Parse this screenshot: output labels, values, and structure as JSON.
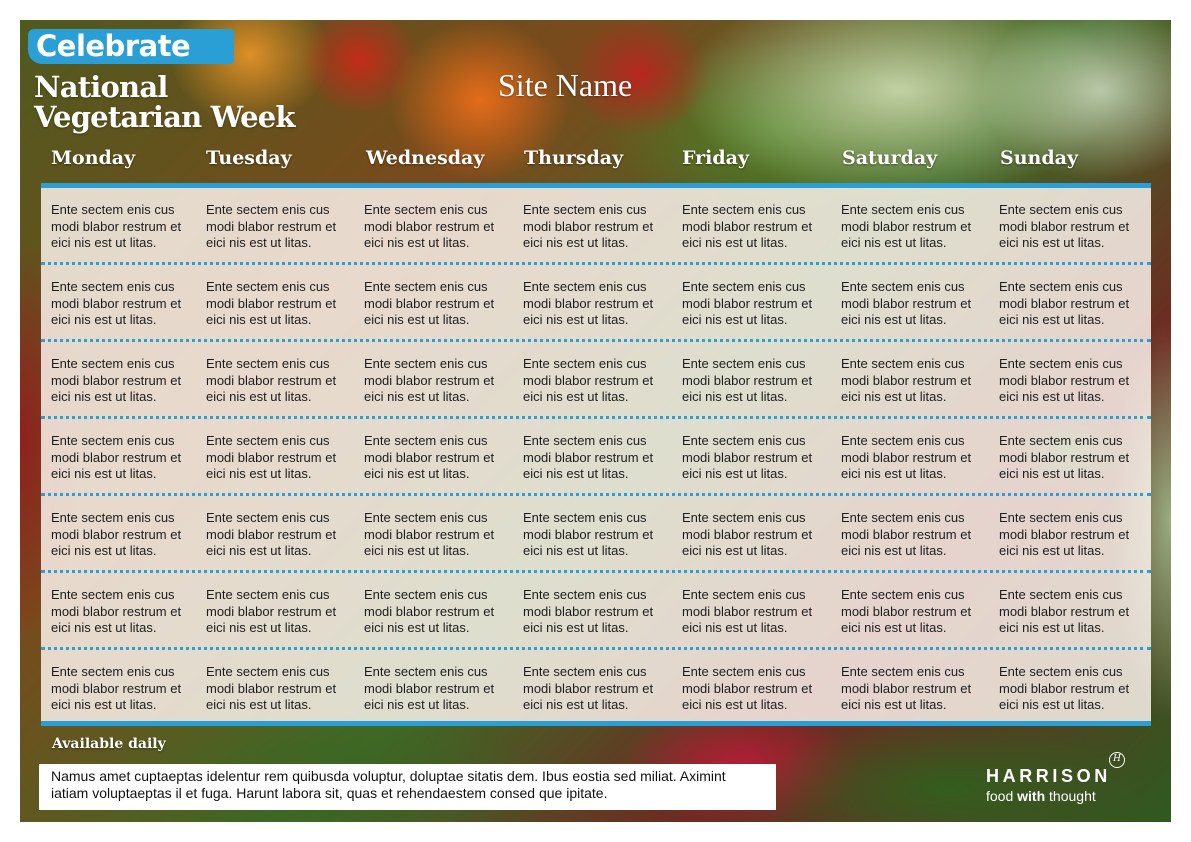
{
  "header": {
    "celebrate": "Celebrate",
    "title_line1": "National",
    "title_line2": "Vegetarian Week",
    "site_name": "Site Name"
  },
  "days": [
    "Monday",
    "Tuesday",
    "Wednesday",
    "Thursday",
    "Friday",
    "Saturday",
    "Sunday"
  ],
  "menu": {
    "rows": [
      [
        "Ente sectem enis cus modi blabor restrum et eici nis est ut litas.",
        "Ente sectem enis cus modi blabor restrum et eici nis est ut litas.",
        "Ente sectem enis cus modi blabor restrum et eici nis est ut litas.",
        "Ente sectem enis cus modi blabor restrum et eici nis est ut litas.",
        "Ente sectem enis cus modi blabor restrum et eici nis est ut litas.",
        "Ente sectem enis cus modi blabor restrum et eici nis est ut litas.",
        "Ente sectem enis cus modi blabor restrum et eici nis est ut litas."
      ],
      [
        "Ente sectem enis cus modi blabor restrum et eici nis est ut litas.",
        "Ente sectem enis cus modi blabor restrum et eici nis est ut litas.",
        "Ente sectem enis cus modi blabor restrum et eici nis est ut litas.",
        "Ente sectem enis cus modi blabor restrum et eici nis est ut litas.",
        "Ente sectem enis cus modi blabor restrum et eici nis est ut litas.",
        "Ente sectem enis cus modi blabor restrum et eici nis est ut litas.",
        "Ente sectem enis cus modi blabor restrum et eici nis est ut litas."
      ],
      [
        "Ente sectem enis cus modi blabor restrum et eici nis est ut litas.",
        "Ente sectem enis cus modi blabor restrum et eici nis est ut litas.",
        "Ente sectem enis cus modi blabor restrum et eici nis est ut litas.",
        "Ente sectem enis cus modi blabor restrum et eici nis est ut litas.",
        "Ente sectem enis cus modi blabor restrum et eici nis est ut litas.",
        "Ente sectem enis cus modi blabor restrum et eici nis est ut litas.",
        "Ente sectem enis cus modi blabor restrum et eici nis est ut litas."
      ],
      [
        "Ente sectem enis cus modi blabor restrum et eici nis est ut litas.",
        "Ente sectem enis cus modi blabor restrum et eici nis est ut litas.",
        "Ente sectem enis cus modi blabor restrum et eici nis est ut litas.",
        "Ente sectem enis cus modi blabor restrum et eici nis est ut litas.",
        "Ente sectem enis cus modi blabor restrum et eici nis est ut litas.",
        "Ente sectem enis cus modi blabor restrum et eici nis est ut litas.",
        "Ente sectem enis cus modi blabor restrum et eici nis est ut litas."
      ],
      [
        "Ente sectem enis cus modi blabor restrum et eici nis est ut litas.",
        "Ente sectem enis cus modi blabor restrum et eici nis est ut litas.",
        "Ente sectem enis cus modi blabor restrum et eici nis est ut litas.",
        "Ente sectem enis cus modi blabor restrum et eici nis est ut litas.",
        "Ente sectem enis cus modi blabor restrum et eici nis est ut litas.",
        "Ente sectem enis cus modi blabor restrum et eici nis est ut litas.",
        "Ente sectem enis cus modi blabor restrum et eici nis est ut litas."
      ],
      [
        "Ente sectem enis cus modi blabor restrum et eici nis est ut litas.",
        "Ente sectem enis cus modi blabor restrum et eici nis est ut litas.",
        "Ente sectem enis cus modi blabor restrum et eici nis est ut litas.",
        "Ente sectem enis cus modi blabor restrum et eici nis est ut litas.",
        "Ente sectem enis cus modi blabor restrum et eici nis est ut litas.",
        "Ente sectem enis cus modi blabor restrum et eici nis est ut litas.",
        "Ente sectem enis cus modi blabor restrum et eici nis est ut litas."
      ],
      [
        "Ente sectem enis cus modi blabor restrum et eici nis est ut litas.",
        "Ente sectem enis cus modi blabor restrum et eici nis est ut litas.",
        "Ente sectem enis cus modi blabor restrum et eici nis est ut litas.",
        "Ente sectem enis cus modi blabor restrum et eici nis est ut litas.",
        "Ente sectem enis cus modi blabor restrum et eici nis est ut litas.",
        "Ente sectem enis cus modi blabor restrum et eici nis est ut litas.",
        "Ente sectem enis cus modi blabor restrum et eici nis est ut litas."
      ]
    ]
  },
  "footer": {
    "available_label": "Available daily",
    "note": "Namus amet cuptaeptas idelentur rem quibusda voluptur, doluptae sitatis dem. Ibus eostia sed miliat. Aximint iatiam voluptaeptas il et fuga. Harunt labora sit, quas et rehendaestem consed que ipitate."
  },
  "logo": {
    "name": "HARRISON",
    "tag_prefix": "food",
    "tag_bold": "with",
    "tag_suffix": "thought",
    "mark": "H"
  },
  "colors": {
    "accent": "#2a9fd6",
    "panel": "#fdf4ee",
    "text": "#1d1d1d"
  }
}
